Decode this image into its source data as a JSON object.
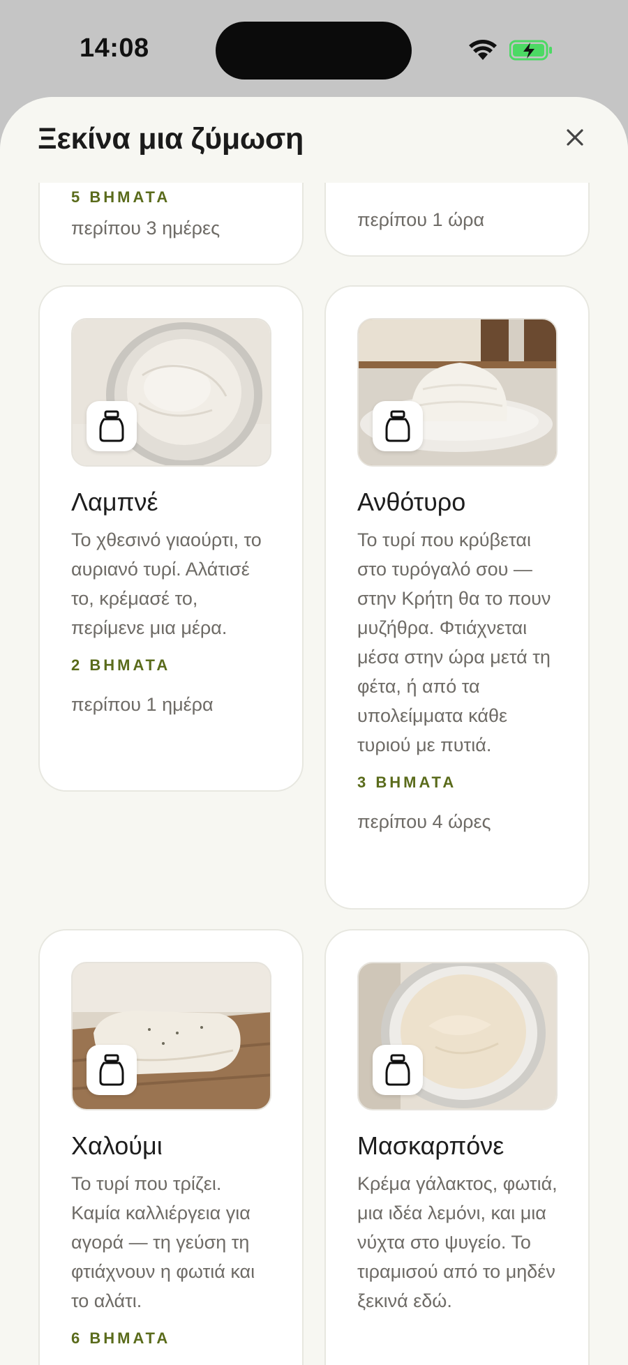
{
  "status": {
    "time": "14:08"
  },
  "sheet": {
    "title": "Ξεκίνα μια ζύμωση"
  },
  "top_cards": [
    {
      "steps": "5 ΒΗΜΑΤΑ",
      "time": "περίπου 3 ημέρες"
    },
    {
      "time": "περίπου 1 ώρα"
    }
  ],
  "cards": [
    {
      "title": "Λαμπνέ",
      "description": "Το χθεσινό γιαούρτι, το αυριανό τυρί. Αλάτισέ το, κρέμασέ το, περίμενε μια μέρα.",
      "steps": "2 ΒΗΜΑΤΑ",
      "time": "περίπου 1 ημέρα"
    },
    {
      "title": "Ανθότυρο",
      "description": "Το τυρί που κρύβεται στο τυρόγαλό σου — στην Κρήτη θα το πουν μυζήθρα. Φτιάχνεται μέσα στην ώρα μετά τη φέτα, ή από τα υπολείμματα κάθε τυριού με πυτιά.",
      "steps": "3 ΒΗΜΑΤΑ",
      "time": "περίπου 4 ώρες"
    },
    {
      "title": "Χαλούμι",
      "description": "Το τυρί που τρίζει. Καμία καλλιέργεια για αγορά — τη γεύση τη φτιάχνουν η φωτιά και το αλάτι.",
      "steps": "6 ΒΗΜΑΤΑ",
      "time": ""
    },
    {
      "title": "Μασκαρπόνε",
      "description": "Κρέμα γάλακτος, φωτιά, μια ιδέα λεμόνι, και μια νύχτα στο ψυγείο. Το τιραμισού από το μηδέν ξεκινά εδώ.",
      "steps": "",
      "time": ""
    }
  ],
  "icons": {
    "close": "close-icon",
    "jar": "jar-icon",
    "wifi": "wifi-icon",
    "battery": "battery-charging-icon"
  },
  "colors": {
    "accent": "#5a6b1b",
    "sheet_bg": "#f7f7f2",
    "battery": "#4cd964"
  }
}
